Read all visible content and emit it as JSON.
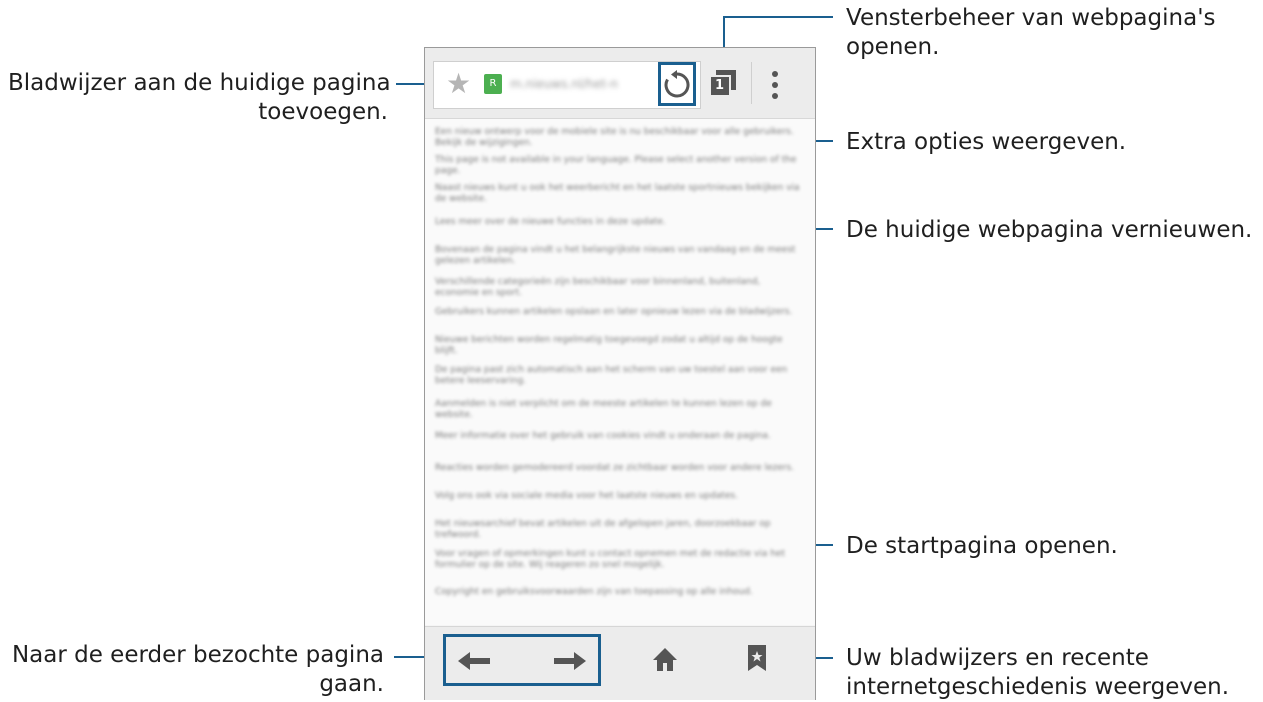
{
  "callouts": {
    "bookmark_add": "Bladwijzer aan de huidige pagina\ntoevoegen.",
    "bookmark_add_l1": "Bladwijzer aan de huidige pagina",
    "bookmark_add_l2": "toevoegen.",
    "window_mgmt_l1": "Vensterbeheer van webpagina's",
    "window_mgmt_l2": "openen.",
    "extra_options": "Extra opties weergeven.",
    "refresh": "De huidige webpagina vernieuwen.",
    "home": "De startpagina openen.",
    "back_forward_l1": "Naar de eerder bezochte pagina",
    "back_forward_l2": "gaan.",
    "bookmarks_history_l1": "Uw bladwijzers en recente",
    "bookmarks_history_l2": "internetgeschiedenis weergeven."
  },
  "browser": {
    "url_text": "m.nieuws.nl/het-n",
    "favicon_letter": "R",
    "tab_count": "1",
    "content_paragraphs": [
      "Een nieuw ontwerp voor de mobiele site is nu beschikbaar voor alle gebruikers. Bekijk de wijzigingen.",
      "This page is not available in your language. Please select another version of the page.",
      "Naast nieuws kunt u ook het weerbericht en het laatste sportnieuws bekijken via de website.",
      "Lees meer over de nieuwe functies in deze update.",
      "Bovenaan de pagina vindt u het belangrijkste nieuws van vandaag en de meest gelezen artikelen.",
      "Verschillende categorieën zijn beschikbaar voor binnenland, buitenland, economie en sport.",
      "Gebruikers kunnen artikelen opslaan en later opnieuw lezen via de bladwijzers.",
      "Nieuwe berichten worden regelmatig toegevoegd zodat u altijd op de hoogte blijft.",
      "De pagina past zich automatisch aan het scherm van uw toestel aan voor een betere leeservaring.",
      "Aanmelden is niet verplicht om de meeste artikelen te kunnen lezen op de website.",
      "Meer informatie over het gebruik van cookies vindt u onderaan de pagina.",
      "Reacties worden gemodereerd voordat ze zichtbaar worden voor andere lezers.",
      "Volg ons ook via sociale media voor het laatste nieuws en updates.",
      "Het nieuwsarchief bevat artikelen uit de afgelopen jaren, doorzoekbaar op trefwoord.",
      "Voor vragen of opmerkingen kunt u contact opnemen met de redactie via het formulier op de site. Wij reageren zo snel mogelijk.",
      "Copyright en gebruiksvoorwaarden zijn van toepassing op alle inhoud."
    ]
  }
}
